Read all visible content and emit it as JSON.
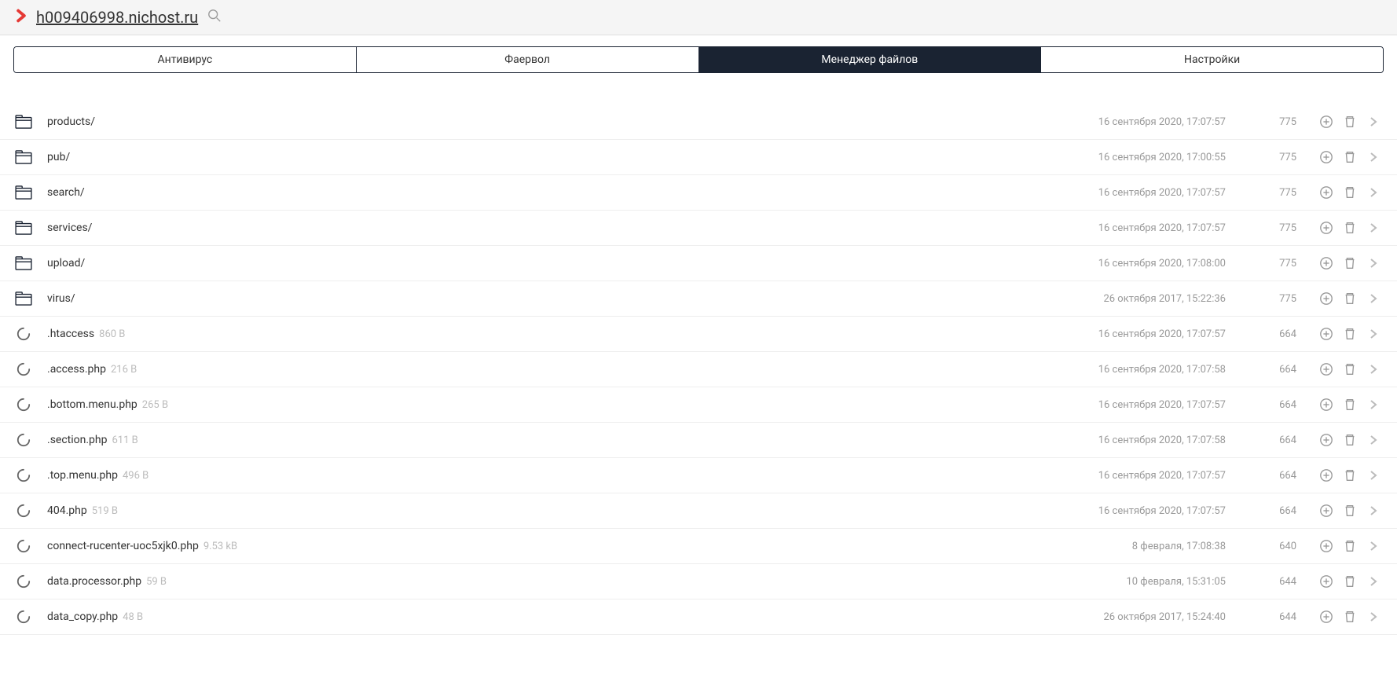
{
  "header": {
    "hostname": "h009406998.nichost.ru"
  },
  "tabs": [
    {
      "label": "Антивирус",
      "active": false
    },
    {
      "label": "Фаервол",
      "active": false
    },
    {
      "label": "Менеджер файлов",
      "active": true
    },
    {
      "label": "Настройки",
      "active": false
    }
  ],
  "files": [
    {
      "type": "folder",
      "name": "products/",
      "size": "",
      "date": "16 сентября 2020, 17:07:57",
      "perms": "775"
    },
    {
      "type": "folder",
      "name": "pub/",
      "size": "",
      "date": "16 сентября 2020, 17:00:55",
      "perms": "775"
    },
    {
      "type": "folder",
      "name": "search/",
      "size": "",
      "date": "16 сентября 2020, 17:07:57",
      "perms": "775"
    },
    {
      "type": "folder",
      "name": "services/",
      "size": "",
      "date": "16 сентября 2020, 17:07:57",
      "perms": "775"
    },
    {
      "type": "folder",
      "name": "upload/",
      "size": "",
      "date": "16 сентября 2020, 17:08:00",
      "perms": "775"
    },
    {
      "type": "folder",
      "name": "virus/",
      "size": "",
      "date": "26 октября 2017, 15:22:36",
      "perms": "775"
    },
    {
      "type": "file",
      "name": ".htaccess",
      "size": "860 B",
      "date": "16 сентября 2020, 17:07:57",
      "perms": "664"
    },
    {
      "type": "file",
      "name": ".access.php",
      "size": "216 B",
      "date": "16 сентября 2020, 17:07:58",
      "perms": "664"
    },
    {
      "type": "file",
      "name": ".bottom.menu.php",
      "size": "265 B",
      "date": "16 сентября 2020, 17:07:57",
      "perms": "664"
    },
    {
      "type": "file",
      "name": ".section.php",
      "size": "611 B",
      "date": "16 сентября 2020, 17:07:58",
      "perms": "664"
    },
    {
      "type": "file",
      "name": ".top.menu.php",
      "size": "496 B",
      "date": "16 сентября 2020, 17:07:57",
      "perms": "664"
    },
    {
      "type": "file",
      "name": "404.php",
      "size": "519 B",
      "date": "16 сентября 2020, 17:07:57",
      "perms": "664"
    },
    {
      "type": "file",
      "name": "connect-rucenter-uoc5xjk0.php",
      "size": "9.53 kB",
      "date": "8 февраля, 17:08:38",
      "perms": "640"
    },
    {
      "type": "file",
      "name": "data.processor.php",
      "size": "59 B",
      "date": "10 февраля, 15:31:05",
      "perms": "644"
    },
    {
      "type": "file",
      "name": "data_copy.php",
      "size": "48 B",
      "date": "26 октября 2017, 15:24:40",
      "perms": "644"
    }
  ]
}
